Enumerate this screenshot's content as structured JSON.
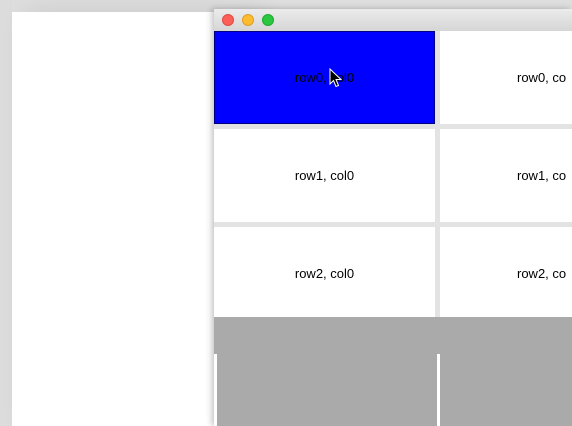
{
  "window": {
    "controls": [
      "close",
      "minimize",
      "zoom"
    ]
  },
  "table": {
    "rows": [
      [
        "row0, col0",
        "row0, co"
      ],
      [
        "row1, col0",
        "row1, co"
      ],
      [
        "row2, col0",
        "row2, co"
      ]
    ],
    "selected_cell": "row0, col0"
  },
  "colors": {
    "selected_bg": "#0000ff",
    "cell_bg": "#ffffff",
    "grid_gap": "#e3e3e3",
    "empty_area": "#aaaaaa",
    "close": "#fc5f57",
    "minimize": "#fdbc2e",
    "zoom": "#2ac840"
  },
  "icons": {
    "cursor": "arrow-cursor-icon"
  }
}
